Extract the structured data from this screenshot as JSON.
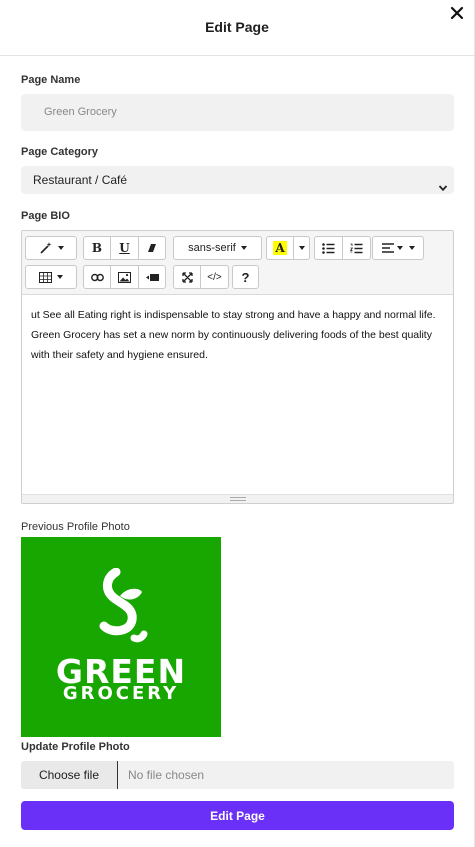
{
  "modal": {
    "title": "Edit Page"
  },
  "fields": {
    "page_name_label": "Page Name",
    "page_name_value": "Green Grocery",
    "page_category_label": "Page Category",
    "page_category_value": "Restaurant / Café",
    "page_bio_label": "Page BIO"
  },
  "editor": {
    "font_family": "sans-serif",
    "text": "ut See all Eating right is indispensable to stay strong and have a happy and normal life. Green Grocery has set a new norm by continuously delivering foods of the best quality with their safety and hygiene ensured.",
    "toolbar_icons": [
      "magic-wand-icon",
      "bold-icon",
      "underline-icon",
      "eraser-icon",
      "font-family-dropdown",
      "text-color-icon",
      "unordered-list-icon",
      "ordered-list-icon",
      "align-icon",
      "table-icon",
      "link-icon",
      "picture-icon",
      "video-icon",
      "fullscreen-icon",
      "code-view-icon",
      "help-icon"
    ],
    "bold_glyph": "B",
    "underline_glyph": "U",
    "color_glyph": "A",
    "code_glyph": "</>",
    "help_glyph": "?"
  },
  "photo": {
    "previous_label": "Previous Profile Photo",
    "brand_line1": "GREEN",
    "brand_line2": "GROCERY",
    "background_color": "#18a700",
    "update_label": "Update Profile Photo"
  },
  "file_input": {
    "button_label": "Choose file",
    "status": "No file chosen"
  },
  "submit": {
    "label": "Edit Page",
    "color": "#6a30f8"
  }
}
